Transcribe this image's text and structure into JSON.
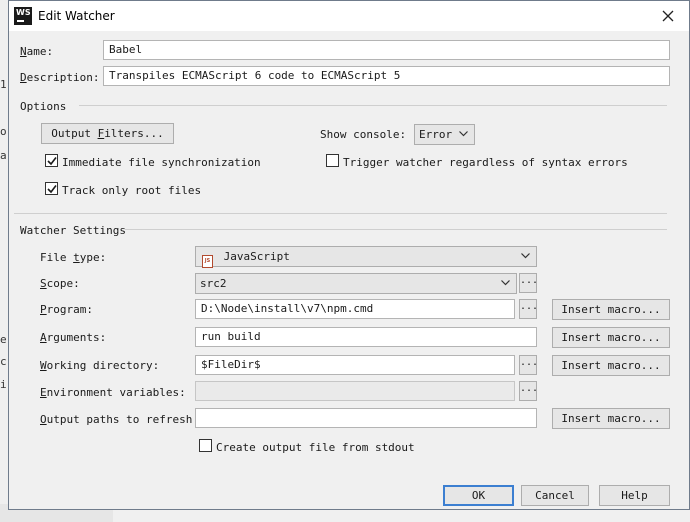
{
  "dialog": {
    "title": "Edit Watcher",
    "logo_text": "WS"
  },
  "fields": {
    "name_label": "Name:",
    "name_value": "Babel",
    "description_label": "Description:",
    "description_value": "Transpiles ECMAScript 6 code to ECMAScript 5"
  },
  "options": {
    "section_title": "Options",
    "output_filters_label": "Output Filters...",
    "show_console_label": "Show console:",
    "show_console_value": "Error",
    "immediate_sync_label": "Immediate file synchronization",
    "immediate_sync_checked": true,
    "trigger_label": "Trigger watcher regardless of syntax errors",
    "trigger_checked": false,
    "track_root_label": "Track only root files",
    "track_root_checked": true
  },
  "watcher": {
    "section_title": "Watcher Settings",
    "file_type_label": "File type:",
    "file_type_value": "JavaScript",
    "file_type_icon_text": "JS",
    "scope_label": "Scope:",
    "scope_value": "src2",
    "program_label": "Program:",
    "program_value": "D:\\Node\\install\\v7\\npm.cmd",
    "arguments_label": "Arguments:",
    "arguments_value": "run build",
    "working_dir_label": "Working directory:",
    "working_dir_value": "$FileDir$",
    "env_label": "Environment variables:",
    "env_value": "",
    "output_paths_label": "Output paths to refresh:",
    "output_paths_value": "",
    "create_output_label": "Create output file from stdout",
    "create_output_checked": false,
    "insert_macro_label": "Insert macro...",
    "browse_label": "..."
  },
  "footer": {
    "ok_label": "OK",
    "cancel_label": "Cancel",
    "help_label": "Help"
  },
  "background": {
    "fragments": [
      "1",
      "o",
      "a",
      "e",
      "c",
      "i"
    ]
  },
  "colors": {
    "accent": "#3c7fd1",
    "dialog_bg": "#f0f0f0",
    "border": "#6f7b8b"
  }
}
